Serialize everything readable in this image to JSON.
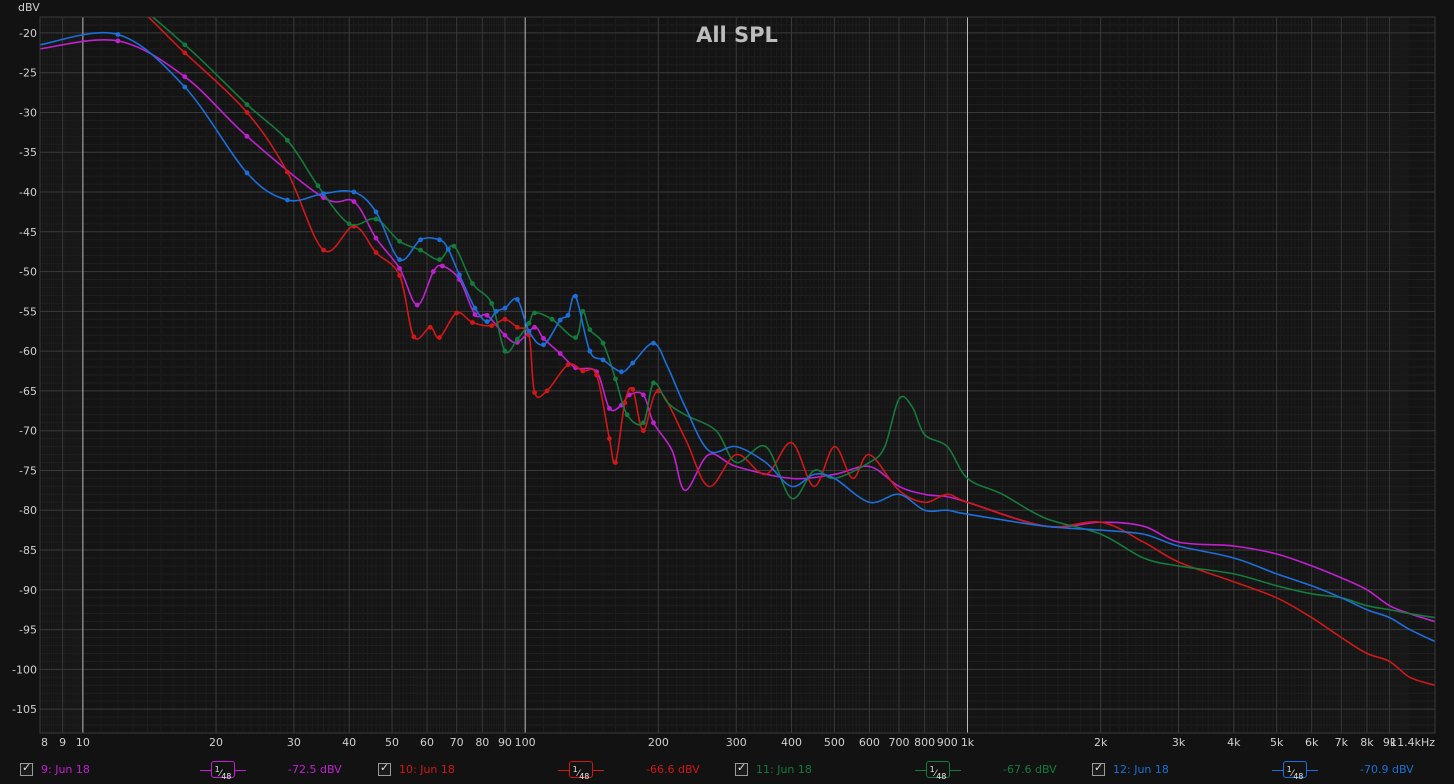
{
  "chart_data": {
    "type": "line",
    "title": "All SPL",
    "ylabel": "dBV",
    "xlabel": "",
    "x_scale": "log",
    "xlim": [
      8,
      11400
    ],
    "ylim": [
      -108,
      -18
    ],
    "grid": true,
    "y_ticks": [
      -20,
      -25,
      -30,
      -35,
      -40,
      -45,
      -50,
      -55,
      -60,
      -65,
      -70,
      -75,
      -80,
      -85,
      -90,
      -95,
      -100,
      -105
    ],
    "x_ticks": [
      {
        "v": 8,
        "label": "8"
      },
      {
        "v": 9,
        "label": "9"
      },
      {
        "v": 10,
        "label": "10"
      },
      {
        "v": 20,
        "label": "20"
      },
      {
        "v": 30,
        "label": "30"
      },
      {
        "v": 40,
        "label": "40"
      },
      {
        "v": 50,
        "label": "50"
      },
      {
        "v": 60,
        "label": "60"
      },
      {
        "v": 70,
        "label": "70"
      },
      {
        "v": 80,
        "label": "80"
      },
      {
        "v": 90,
        "label": "90"
      },
      {
        "v": 100,
        "label": "100"
      },
      {
        "v": 200,
        "label": "200"
      },
      {
        "v": 300,
        "label": "300"
      },
      {
        "v": 400,
        "label": "400"
      },
      {
        "v": 500,
        "label": "500"
      },
      {
        "v": 600,
        "label": "600"
      },
      {
        "v": 700,
        "label": "700"
      },
      {
        "v": 800,
        "label": "800"
      },
      {
        "v": 900,
        "label": "900"
      },
      {
        "v": 1000,
        "label": "1k"
      },
      {
        "v": 2000,
        "label": "2k"
      },
      {
        "v": 3000,
        "label": "3k"
      },
      {
        "v": 4000,
        "label": "4k"
      },
      {
        "v": 5000,
        "label": "5k"
      },
      {
        "v": 6000,
        "label": "6k"
      },
      {
        "v": 7000,
        "label": "7k"
      },
      {
        "v": 8000,
        "label": "8k"
      },
      {
        "v": 9000,
        "label": "9k"
      },
      {
        "v": 11400,
        "label": "11.4kHz"
      }
    ],
    "series": [
      {
        "name": "9: Jun 18",
        "color": "#c020d0",
        "smoothing": "1/48",
        "readout": "-72.5 dBV",
        "points": [
          [
            8,
            -22
          ],
          [
            12,
            -21
          ],
          [
            17,
            -25.5
          ],
          [
            23.5,
            -33
          ],
          [
            35,
            -40.7
          ],
          [
            41,
            -41.2
          ],
          [
            46,
            -45.8
          ],
          [
            52,
            -49.6
          ],
          [
            57,
            -54.2
          ],
          [
            62,
            -50
          ],
          [
            65,
            -49.3
          ],
          [
            71,
            -51
          ],
          [
            77,
            -55.4
          ],
          [
            82,
            -55.5
          ],
          [
            90,
            -58
          ],
          [
            96,
            -58.9
          ],
          [
            105,
            -57
          ],
          [
            110,
            -58.4
          ],
          [
            120,
            -60.3
          ],
          [
            130,
            -62.1
          ],
          [
            145,
            -62.6
          ],
          [
            155,
            -67.2
          ],
          [
            165,
            -66.8
          ],
          [
            172,
            -65.5
          ],
          [
            185,
            -65.5
          ],
          [
            195,
            -69
          ],
          [
            215,
            -72.5
          ],
          [
            230,
            -77.5
          ],
          [
            260,
            -73
          ],
          [
            300,
            -74.5
          ],
          [
            400,
            -76
          ],
          [
            500,
            -75.5
          ],
          [
            600,
            -74.5
          ],
          [
            700,
            -77
          ],
          [
            800,
            -78
          ],
          [
            900,
            -78.3
          ],
          [
            1000,
            -79
          ],
          [
            1500,
            -82
          ],
          [
            2000,
            -81.5
          ],
          [
            2500,
            -82
          ],
          [
            3000,
            -84
          ],
          [
            4000,
            -84.5
          ],
          [
            5000,
            -85.5
          ],
          [
            6000,
            -87
          ],
          [
            7000,
            -88.5
          ],
          [
            8000,
            -90
          ],
          [
            9000,
            -92
          ],
          [
            10000,
            -93
          ],
          [
            11400,
            -94
          ]
        ]
      },
      {
        "name": "10: Jun 18",
        "color": "#d01818",
        "smoothing": "1/48",
        "readout": "-66.6 dBV",
        "points": [
          [
            8,
            -12
          ],
          [
            12,
            -15
          ],
          [
            17,
            -22.5
          ],
          [
            23.5,
            -30
          ],
          [
            29,
            -37.5
          ],
          [
            35,
            -47.3
          ],
          [
            41,
            -44.3
          ],
          [
            46,
            -47.6
          ],
          [
            52,
            -50.5
          ],
          [
            56,
            -58.2
          ],
          [
            61,
            -57
          ],
          [
            64,
            -58.3
          ],
          [
            70,
            -55.2
          ],
          [
            76,
            -56.4
          ],
          [
            84,
            -56.8
          ],
          [
            90,
            -56
          ],
          [
            96,
            -57
          ],
          [
            102,
            -58
          ],
          [
            105,
            -65.2
          ],
          [
            112,
            -65
          ],
          [
            125,
            -61.7
          ],
          [
            135,
            -62.5
          ],
          [
            145,
            -63
          ],
          [
            155,
            -71
          ],
          [
            160,
            -74
          ],
          [
            168,
            -66.5
          ],
          [
            175,
            -64.8
          ],
          [
            185,
            -70
          ],
          [
            200,
            -65
          ],
          [
            230,
            -71
          ],
          [
            260,
            -77
          ],
          [
            300,
            -73
          ],
          [
            350,
            -75.5
          ],
          [
            400,
            -71.5
          ],
          [
            450,
            -77
          ],
          [
            500,
            -72
          ],
          [
            550,
            -76
          ],
          [
            600,
            -73
          ],
          [
            700,
            -77.5
          ],
          [
            800,
            -79
          ],
          [
            900,
            -78
          ],
          [
            1000,
            -79
          ],
          [
            1500,
            -82
          ],
          [
            2000,
            -81.5
          ],
          [
            2500,
            -84
          ],
          [
            3000,
            -86.5
          ],
          [
            4000,
            -89
          ],
          [
            5000,
            -91
          ],
          [
            6000,
            -93.5
          ],
          [
            7000,
            -96
          ],
          [
            8000,
            -98
          ],
          [
            9000,
            -99
          ],
          [
            10000,
            -101
          ],
          [
            11400,
            -102
          ]
        ]
      },
      {
        "name": "11: Jun 18",
        "color": "#157a3c",
        "smoothing": "1/48",
        "readout": "-67.6 dBV",
        "points": [
          [
            8,
            -12
          ],
          [
            12,
            -15
          ],
          [
            17,
            -21.5
          ],
          [
            23.5,
            -29
          ],
          [
            29,
            -33.5
          ],
          [
            34,
            -39.2
          ],
          [
            40,
            -44
          ],
          [
            46,
            -43.4
          ],
          [
            52,
            -46.2
          ],
          [
            58,
            -47.3
          ],
          [
            64,
            -48.5
          ],
          [
            69,
            -46.8
          ],
          [
            76,
            -51.5
          ],
          [
            84,
            -54
          ],
          [
            90,
            -60
          ],
          [
            96,
            -58.5
          ],
          [
            102,
            -56.5
          ],
          [
            105,
            -55.2
          ],
          [
            115,
            -56
          ],
          [
            130,
            -58.3
          ],
          [
            135,
            -55
          ],
          [
            140,
            -57.3
          ],
          [
            150,
            -59
          ],
          [
            160,
            -63.5
          ],
          [
            170,
            -68
          ],
          [
            185,
            -69
          ],
          [
            195,
            -64
          ],
          [
            210,
            -66.5
          ],
          [
            230,
            -68
          ],
          [
            270,
            -70
          ],
          [
            300,
            -74
          ],
          [
            350,
            -72
          ],
          [
            400,
            -78.5
          ],
          [
            450,
            -75
          ],
          [
            500,
            -76
          ],
          [
            600,
            -74
          ],
          [
            650,
            -72
          ],
          [
            700,
            -66
          ],
          [
            750,
            -67
          ],
          [
            800,
            -70.5
          ],
          [
            900,
            -72
          ],
          [
            1000,
            -76
          ],
          [
            1200,
            -78
          ],
          [
            1500,
            -81
          ],
          [
            2000,
            -83
          ],
          [
            2500,
            -86
          ],
          [
            3000,
            -87
          ],
          [
            4000,
            -88
          ],
          [
            5000,
            -89.5
          ],
          [
            6000,
            -90.5
          ],
          [
            7000,
            -91
          ],
          [
            8000,
            -92
          ],
          [
            9000,
            -92.5
          ],
          [
            10000,
            -93
          ],
          [
            11400,
            -93.5
          ]
        ]
      },
      {
        "name": "12: Jun 18",
        "color": "#1c6fd8",
        "smoothing": "1/48",
        "readout": "-70.9 dBV",
        "points": [
          [
            8,
            -21.5
          ],
          [
            12,
            -20.2
          ],
          [
            17,
            -26.8
          ],
          [
            23.5,
            -37.6
          ],
          [
            29,
            -41
          ],
          [
            35,
            -40.2
          ],
          [
            41,
            -40
          ],
          [
            46,
            -42.5
          ],
          [
            52,
            -48.5
          ],
          [
            58,
            -46
          ],
          [
            64,
            -46
          ],
          [
            67,
            -47.2
          ],
          [
            71,
            -50.4
          ],
          [
            77,
            -54.6
          ],
          [
            82,
            -56.3
          ],
          [
            86,
            -55
          ],
          [
            90,
            -54.6
          ],
          [
            96,
            -53.5
          ],
          [
            102,
            -57.5
          ],
          [
            110,
            -59.2
          ],
          [
            120,
            -56.1
          ],
          [
            125,
            -55.5
          ],
          [
            130,
            -53.1
          ],
          [
            140,
            -60
          ],
          [
            150,
            -61.1
          ],
          [
            165,
            -62.6
          ],
          [
            175,
            -61.5
          ],
          [
            195,
            -59
          ],
          [
            210,
            -62
          ],
          [
            230,
            -67
          ],
          [
            260,
            -72.5
          ],
          [
            300,
            -72
          ],
          [
            350,
            -74
          ],
          [
            400,
            -77
          ],
          [
            450,
            -75.5
          ],
          [
            500,
            -76
          ],
          [
            600,
            -79
          ],
          [
            700,
            -78
          ],
          [
            800,
            -80
          ],
          [
            900,
            -80
          ],
          [
            1000,
            -80.5
          ],
          [
            1500,
            -82
          ],
          [
            2000,
            -82.5
          ],
          [
            2500,
            -83
          ],
          [
            3000,
            -84.5
          ],
          [
            4000,
            -86
          ],
          [
            5000,
            -88
          ],
          [
            6000,
            -89.5
          ],
          [
            7000,
            -91
          ],
          [
            8000,
            -92.5
          ],
          [
            9000,
            -93.5
          ],
          [
            10000,
            -95
          ],
          [
            11400,
            -96.5
          ]
        ]
      }
    ]
  },
  "legend": {
    "items": [
      {
        "name": "9: Jun 18",
        "smoothing_num": "1",
        "smoothing_den": "48",
        "readout": "-72.5 dBV",
        "color": "#c020d0"
      },
      {
        "name": "10: Jun 18",
        "smoothing_num": "1",
        "smoothing_den": "48",
        "readout": "-66.6 dBV",
        "color": "#d01818"
      },
      {
        "name": "11: Jun 18",
        "smoothing_num": "1",
        "smoothing_den": "48",
        "readout": "-67.6 dBV",
        "color": "#157a3c"
      },
      {
        "name": "12: Jun 18",
        "smoothing_num": "1",
        "smoothing_den": "48",
        "readout": "-70.9 dBV",
        "color": "#1c6fd8"
      }
    ]
  }
}
